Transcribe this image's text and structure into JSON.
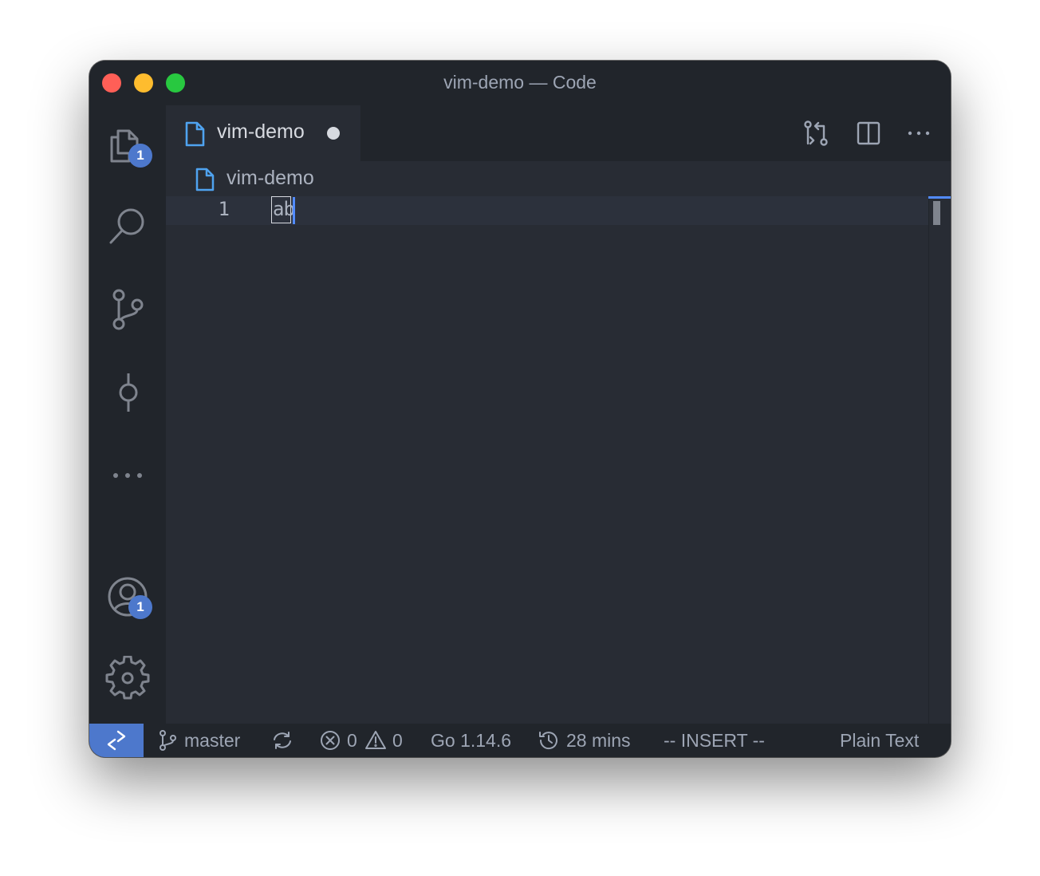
{
  "window": {
    "title": "vim-demo — Code"
  },
  "activity_bar": {
    "explorer_badge": "1",
    "accounts_badge": "1"
  },
  "tab": {
    "label": "vim-demo"
  },
  "breadcrumb": {
    "label": "vim-demo"
  },
  "editor": {
    "line_number": "1",
    "line_text": "ab"
  },
  "status_bar": {
    "branch": "master",
    "errors": "0",
    "warnings": "0",
    "go_version": "Go 1.14.6",
    "time_tracked": "28 mins",
    "vim_mode": "-- INSERT --",
    "language": "Plain Text"
  },
  "colors": {
    "editor_bg": "#282c34",
    "chrome_bg": "#21252b",
    "accent": "#4d78cc",
    "cursor": "#528bff",
    "file_icon": "#4fa3f0"
  }
}
